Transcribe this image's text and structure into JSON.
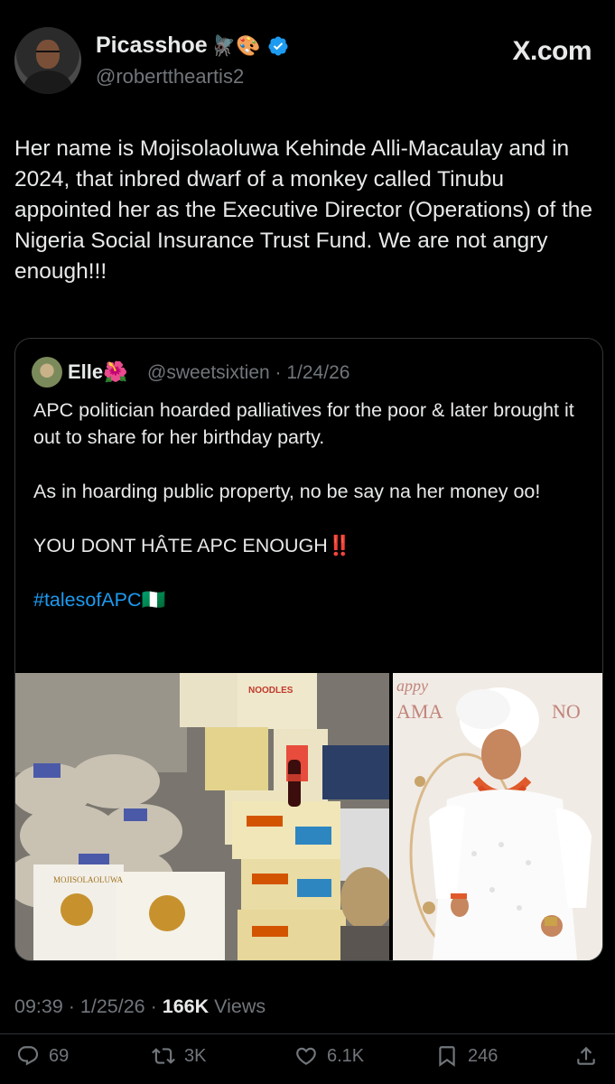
{
  "author": {
    "name": "Picasshoe",
    "emojis": "🪰🎨",
    "handle": "@roberttheartis2",
    "verified": true
  },
  "site": "X.com",
  "tweet": {
    "text": "Her name is Mojisolaoluwa Kehinde Alli-Macaulay and in 2024, that inbred dwarf of a monkey called Tinubu appointed her as the Executive Director (Operations) of the Nigeria Social Insurance Trust Fund. We are not angry enough!!!"
  },
  "quote": {
    "name": "Elle",
    "name_emoji": "🌺",
    "handle_date": "@sweetsixtien · 1/24/26",
    "para1": "APC politician hoarded palliatives for the poor & later brought it out to share for her birthday party.",
    "para2": "As in hoarding public property, no be say na her money oo!",
    "para3": "YOU DONT HÂTE APC ENOUGH",
    "para3_mark": "‼️",
    "hashtag": "#talesofAPC",
    "hashtag_flag": "🇳🇬",
    "images": [
      {
        "alt": "Stacks of Indomie noodle cartons and palliative bags",
        "carton_text": "NOODLES",
        "bag_text": "MOJISOLAOLUWA"
      },
      {
        "alt": "Woman in white gele and coral beads at birthday backdrop",
        "backdrop_text_left": "AMA",
        "backdrop_text_right": "NO"
      }
    ]
  },
  "meta": {
    "time_date": "09:39 · 1/25/26 · ",
    "views_count": "166K",
    "views_label": " Views"
  },
  "actions": {
    "replies": "69",
    "reposts": "3K",
    "likes": "6.1K",
    "bookmarks": "246"
  },
  "colors": {
    "background": "#000000",
    "text": "#e7e9ea",
    "muted": "#71767b",
    "link": "#1d9bf0",
    "verified": "#1d9bf0",
    "border": "#333639"
  }
}
